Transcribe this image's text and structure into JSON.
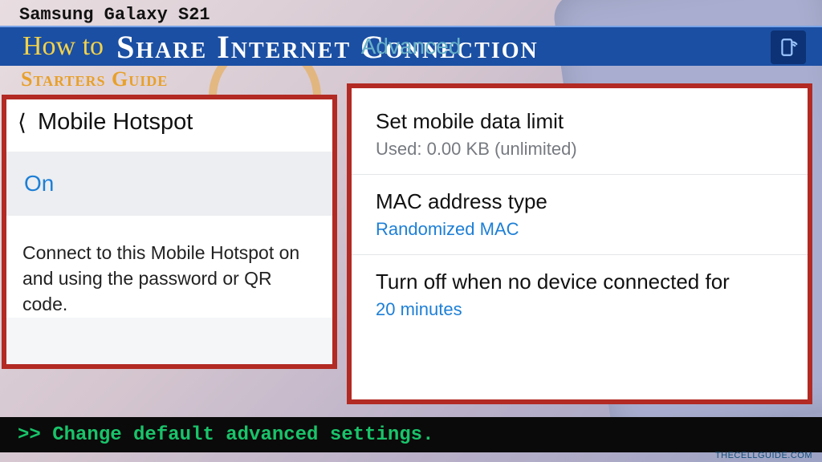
{
  "header": {
    "device": "Samsung Galaxy S21",
    "how_to": "How to",
    "title": "Share Internet Connection",
    "ghost": "Advanced",
    "subtitle": "Starters Guide"
  },
  "left_panel": {
    "title": "Mobile Hotspot",
    "status": "On",
    "description": "Connect to this Mobile Hotspot on and using the password or QR code."
  },
  "right_panel": {
    "settings": [
      {
        "title": "Set mobile data limit",
        "sub": "Used: 0.00 KB (unlimited)",
        "sub_style": "grey"
      },
      {
        "title": "MAC address type",
        "sub": "Randomized MAC",
        "sub_style": "blue"
      },
      {
        "title": "Turn off when no device connected for",
        "sub": "20 minutes",
        "sub_style": "blue"
      }
    ]
  },
  "caption": ">> Change default advanced settings.",
  "watermark": "THECELLGUIDE.COM"
}
